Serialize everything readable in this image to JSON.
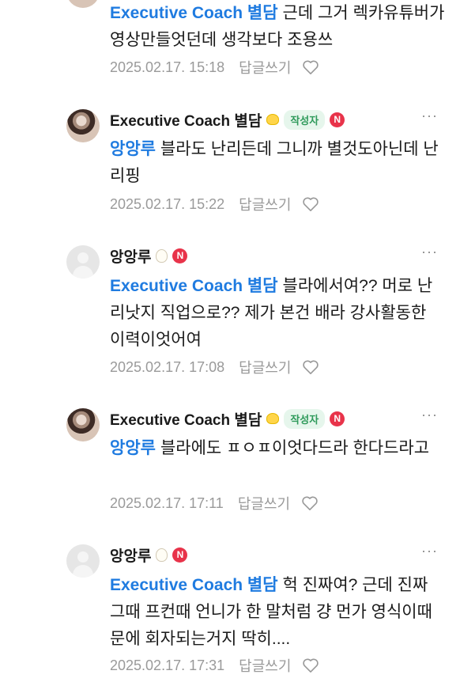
{
  "comments": [
    {
      "author": "",
      "mention": "Executive Coach 별담",
      "text": "근데 그거 렉카유튜버가 영상만들엇던데 생각보다 조용쓰",
      "date": "2025.02.17. 15:18",
      "reply_label": "답글쓰기",
      "heart": "heart-outline-icon"
    },
    {
      "author": "Executive Coach 별담",
      "author_badge": "작성자",
      "mention": "앙앙루",
      "text": "블라도 난리든데 그니까 별것도아닌데 난리핑",
      "date": "2025.02.17. 15:22",
      "reply_label": "답글쓰기",
      "more_label": "···"
    },
    {
      "author": "앙앙루",
      "mention": "Executive Coach 별담",
      "text": "블라에서여?? 머로 난리낫지 직업으로?? 제가 본건 배라 강사활동한 이력이엇어여",
      "date": "2025.02.17. 17:08",
      "reply_label": "답글쓰기",
      "more_label": "···"
    },
    {
      "author": "Executive Coach 별담",
      "author_badge": "작성자",
      "mention": "앙앙루",
      "text": "블라에도 ㅍㅇㅍ이엇다드라 한다드라고",
      "date": "2025.02.17. 17:11",
      "reply_label": "답글쓰기",
      "more_label": "···"
    },
    {
      "author": "앙앙루",
      "mention": "Executive Coach 별담",
      "text": "헉 진짜여? 근데 진짜 그때 프컨때 언니가 한 말처럼 걍 먼가 영식이때문에 회자되는거지 딱히....",
      "date": "2025.02.17. 17:31",
      "reply_label": "답글쓰기",
      "more_label": "···"
    }
  ],
  "n_badge_label": "N",
  "colors": {
    "mention": "#1f7be0",
    "badge_green": "#2f9a5b",
    "n_red": "#e8334a",
    "meta_gray": "#9a9a9a"
  }
}
